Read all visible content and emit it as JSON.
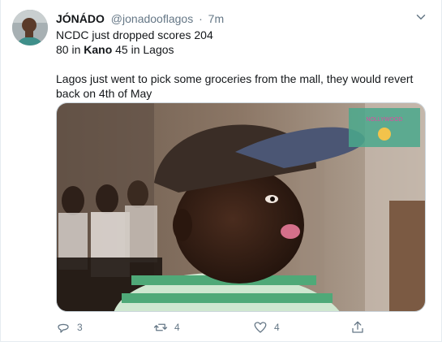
{
  "author": {
    "name": "JÓNÁDO",
    "handle": "@jonadooflagos",
    "separator": "·",
    "time": "7m"
  },
  "tweet": {
    "line1": "NCDC just dropped scores 204",
    "line2_prefix": "80 in ",
    "line2_bold1": "Kano",
    "line2_mid": " 45 in Lagos",
    "paragraph2": "Lagos just went to pick some groceries from the mall, they would revert back on 4th of May"
  },
  "media": {
    "type": "photo",
    "logo_text": "NOLLYWOOD"
  },
  "actions": {
    "reply_count": "3",
    "retweet_count": "4",
    "like_count": "4"
  },
  "icons": {
    "menu": "chevron-down-icon",
    "reply": "reply-icon",
    "retweet": "retweet-icon",
    "like": "heart-icon",
    "share": "share-icon"
  },
  "colors": {
    "text_primary": "#14171a",
    "text_secondary": "#657786",
    "border": "#e6ecf0"
  }
}
